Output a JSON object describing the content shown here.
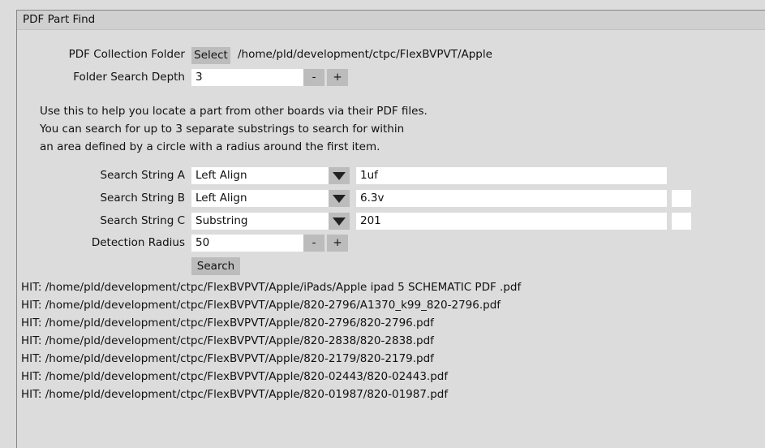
{
  "window": {
    "title": "PDF Part Find"
  },
  "form": {
    "collection_folder": {
      "label": "PDF Collection Folder",
      "select_button": "Select",
      "path": "/home/pld/development/ctpc/FlexBVPVT/Apple"
    },
    "search_depth": {
      "label": "Folder Search Depth",
      "value": "3",
      "decrement": "-",
      "increment": "+"
    },
    "detection_radius": {
      "label": "Detection Radius",
      "value": "50",
      "decrement": "-",
      "increment": "+"
    },
    "search_button": "Search"
  },
  "description": {
    "line1": "Use this to help you locate a part from other boards via their PDF files.",
    "line2": "You can search for up to 3 separate substrings to search for within",
    "line3": "an area defined by a circle with a radius around the first item."
  },
  "search_strings": [
    {
      "label": "Search String A",
      "match_mode": "Left Align",
      "value": "1uf",
      "has_extra_box": false
    },
    {
      "label": "Search String B",
      "match_mode": "Left Align",
      "value": "6.3v",
      "has_extra_box": true
    },
    {
      "label": "Search String C",
      "match_mode": "Substring",
      "value": "201",
      "has_extra_box": true
    }
  ],
  "results": [
    "HIT: /home/pld/development/ctpc/FlexBVPVT/Apple/iPads/Apple ipad 5 SCHEMATIC PDF .pdf",
    "HIT: /home/pld/development/ctpc/FlexBVPVT/Apple/820-2796/A1370_k99_820-2796.pdf",
    "HIT: /home/pld/development/ctpc/FlexBVPVT/Apple/820-2796/820-2796.pdf",
    "HIT: /home/pld/development/ctpc/FlexBVPVT/Apple/820-2838/820-2838.pdf",
    "HIT: /home/pld/development/ctpc/FlexBVPVT/Apple/820-2179/820-2179.pdf",
    "HIT: /home/pld/development/ctpc/FlexBVPVT/Apple/820-02443/820-02443.pdf",
    "HIT: /home/pld/development/ctpc/FlexBVPVT/Apple/820-01987/820-01987.pdf"
  ],
  "colors": {
    "window_background": "#dcdcdc",
    "titlebar_background": "#d0d0d0",
    "button_face": "#bcbcbc",
    "field_background": "#ffffff",
    "border": "#868686",
    "text": "#111111"
  }
}
